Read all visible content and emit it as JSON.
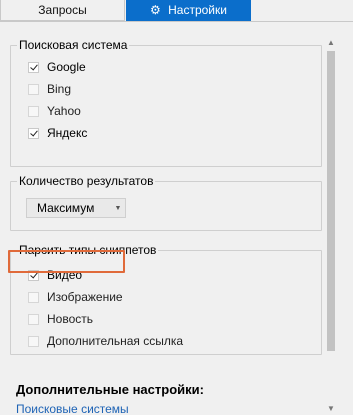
{
  "tabs": [
    {
      "label": "Запросы",
      "active": false
    },
    {
      "label": "Настройки",
      "active": true,
      "icon": "gear-icon"
    }
  ],
  "search_engine_group": {
    "legend": "Поисковая система",
    "items": [
      {
        "label": "Google",
        "checked": true
      },
      {
        "label": "Bing",
        "checked": false
      },
      {
        "label": "Yahoo",
        "checked": false
      },
      {
        "label": "Яндекс",
        "checked": true
      }
    ]
  },
  "results_group": {
    "legend": "Количество результатов",
    "select_value": "Максимум"
  },
  "snippets_group": {
    "legend": "Парсить типы сниппетов",
    "items": [
      {
        "label": "Видео",
        "checked": true
      },
      {
        "label": "Изображение",
        "checked": false
      },
      {
        "label": "Новость",
        "checked": false
      },
      {
        "label": "Дополнительная ссылка",
        "checked": false
      }
    ]
  },
  "extra": {
    "title": "Дополнительные настройки:",
    "link": "Поисковые системы"
  },
  "colors": {
    "accent": "#0b6ecb",
    "highlight": "#e06a3a",
    "link": "#1e63b5"
  }
}
